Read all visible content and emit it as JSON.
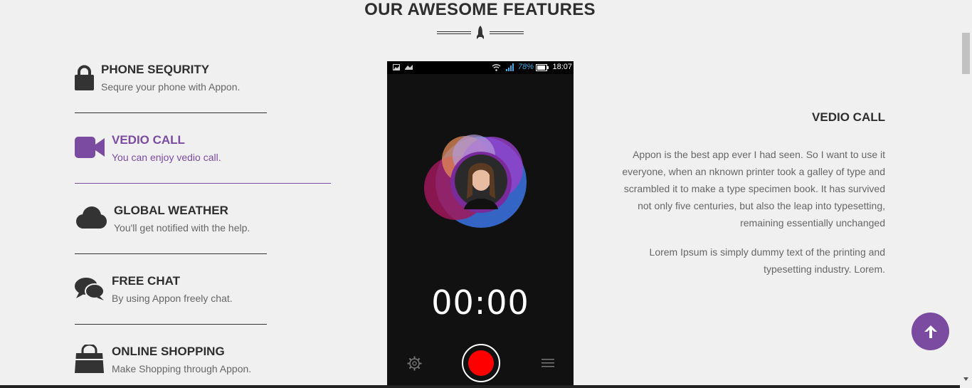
{
  "section": {
    "title": "OUR AWESOME FEATURES"
  },
  "features": [
    {
      "icon": "lock-icon",
      "name": "PHONE SEQURITY",
      "desc": "Sequre your phone with Appon.",
      "active": false
    },
    {
      "icon": "video-camera-icon",
      "name": "VEDIO CALL",
      "desc": "You can enjoy vedio call.",
      "active": true
    },
    {
      "icon": "cloud-icon",
      "name": "GLOBAL WEATHER",
      "desc": "You'll get notified with the help.",
      "active": false
    },
    {
      "icon": "chat-bubbles-icon",
      "name": "FREE CHAT",
      "desc": "By using Appon freely chat.",
      "active": false
    },
    {
      "icon": "shopping-bag-icon",
      "name": "ONLINE SHOPPING",
      "desc": "Make Shopping through Appon.",
      "active": false
    }
  ],
  "phone": {
    "battery": "78%",
    "clock": "18:07",
    "timer": "00:00"
  },
  "detail": {
    "title": "VEDIO CALL",
    "para1": "Appon is the best app ever I had seen. So I want to use it everyone, when an nknown printer took a galley of type and scrambled it to make a type specimen book. It has survived not only five centuries, but also the leap into typesetting, remaining essentially unchanged",
    "para2": "Lorem Ipsum is simply dummy text of the printing and typesetting industry. Lorem."
  },
  "colors": {
    "accent": "#7a4ba0",
    "record": "#ff0000"
  }
}
